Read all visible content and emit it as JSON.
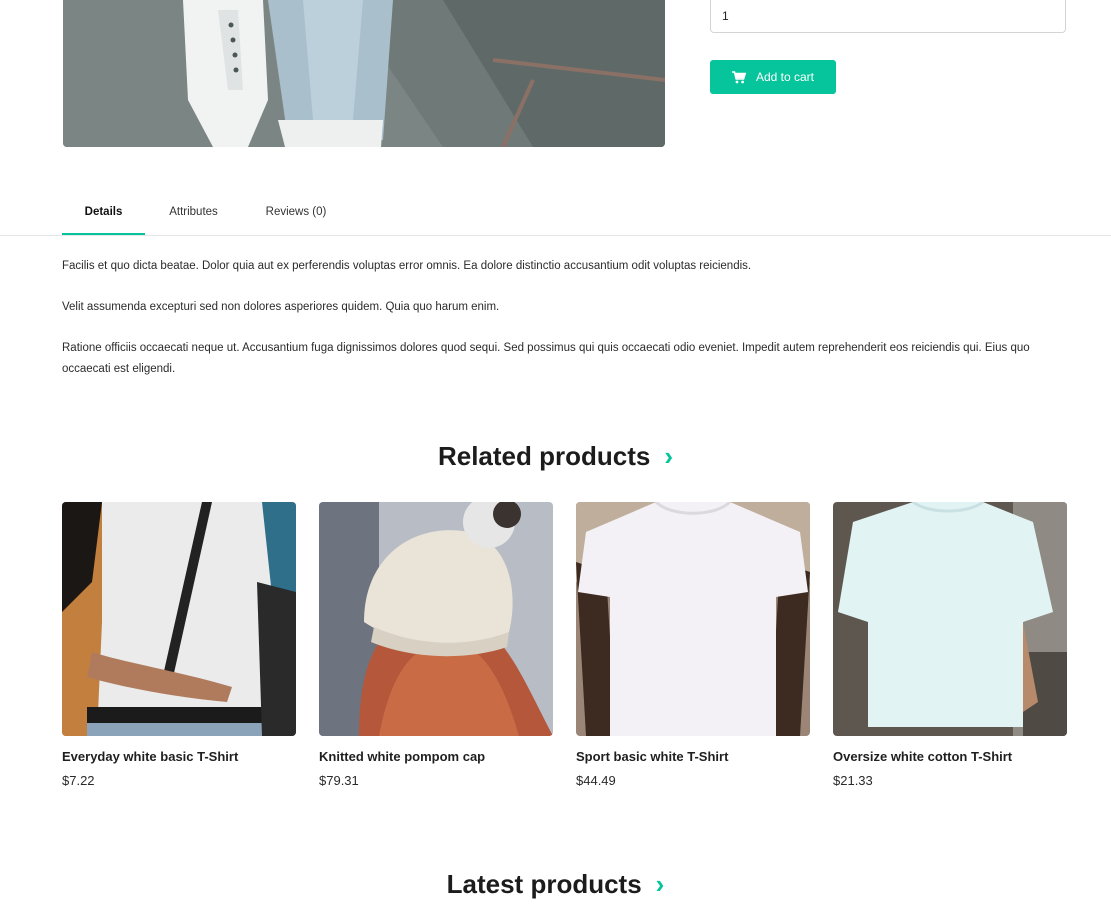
{
  "product": {
    "quantity_value": "1",
    "add_to_cart_label": "Add to cart"
  },
  "tabs": [
    {
      "label": "Details",
      "active": true
    },
    {
      "label": "Attributes",
      "active": false
    },
    {
      "label": "Reviews (0)",
      "active": false
    }
  ],
  "details": {
    "paragraphs": [
      "Facilis et quo dicta beatae. Dolor quia aut ex perferendis voluptas error omnis. Ea dolore distinctio accusantium odit voluptas reiciendis.",
      "Velit assumenda excepturi sed non dolores asperiores quidem. Quia quo harum enim.",
      "Ratione officiis occaecati neque ut. Accusantium fuga dignissimos dolores quod sequi. Sed possimus qui quis occaecati odio eveniet. Impedit autem reprehenderit eos reiciendis qui. Eius quo occaecati est eligendi."
    ]
  },
  "related": {
    "title": "Related products",
    "chevron": "›",
    "items": [
      {
        "name": "Everyday white basic T-Shirt",
        "price": "$7.22"
      },
      {
        "name": "Knitted white pompom cap",
        "price": "$79.31"
      },
      {
        "name": "Sport basic white T-Shirt",
        "price": "$44.49"
      },
      {
        "name": "Oversize white cotton T-Shirt",
        "price": "$21.33"
      }
    ]
  },
  "latest": {
    "title": "Latest products",
    "chevron": "›"
  },
  "colors": {
    "accent": "#06c49b"
  },
  "icons": {
    "cart": "cart-icon",
    "section_link": "chevron-right-icon"
  }
}
